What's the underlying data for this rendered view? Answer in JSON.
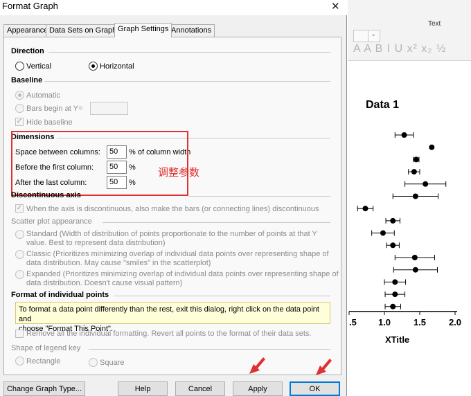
{
  "dialog": {
    "title": "Format Graph",
    "tabs": [
      "Appearance",
      "Data Sets on Graph",
      "Graph Settings",
      "Annotations"
    ],
    "active_tab": "Graph Settings"
  },
  "direction": {
    "title": "Direction",
    "vertical_label": "Vertical",
    "horizontal_label": "Horizontal",
    "selected": "Horizontal"
  },
  "baseline": {
    "title": "Baseline",
    "automatic_label": "Automatic",
    "bars_begin_label": "Bars begin at Y=",
    "bars_begin_value": "",
    "hide_baseline_label": "Hide baseline"
  },
  "dimensions": {
    "title": "Dimensions",
    "space_label": "Space between columns:",
    "space_value": "50",
    "space_unit": "% of column width",
    "before_label": "Before the first column:",
    "before_value": "50",
    "before_unit": "%",
    "after_label": "After the last column:",
    "after_value": "50",
    "after_unit": "%"
  },
  "annotation_text": "调整参数",
  "discontinuous": {
    "title": "Discontinuous axis",
    "option_label": "When the axis is discontinuous, also make the bars (or connecting lines) discontinuous"
  },
  "scatter": {
    "title": "Scatter plot appearance",
    "standard_line1": "Standard (Width of distribution of points proportionate to the number of points at that Y",
    "standard_line2": "value. Best to represent data distribution)",
    "classic_line1": "Classic (Prioritizes minimizing overlap of individual data points over representing shape of",
    "classic_line2": "data distribution. May cause \"smiles\" in the scatterplot)",
    "expanded_line1": "Expanded (Prioritizes minimizing overlap of individual data points over representing shape of",
    "expanded_line2": "data distribution. Doesn't cause visual pattern)"
  },
  "individual_points": {
    "title": "Format of individual points",
    "info_line1": "To format a data point differently than the rest, exit this dialog, right click on the data point and",
    "info_line2": "choose \"Format This Point\".",
    "remove_label": "Remove all the individual formatting. Revert all points to the format of their data sets."
  },
  "legend_key": {
    "title": "Shape of legend key",
    "rectangle_label": "Rectangle",
    "square_label": "Square"
  },
  "buttons": {
    "change_graph_type": "Change Graph Type...",
    "help": "Help",
    "cancel": "Cancel",
    "apply": "Apply",
    "ok": "OK"
  },
  "ribbon": {
    "section_label": "Text",
    "format_glyphs": "A A B I U x² x₂ ½"
  },
  "colors": {
    "highlight_red": "#e03030",
    "dialog_bg": "#f0f0f0",
    "default_button_border": "#0078d7",
    "info_box_bg": "#fefed9"
  },
  "chart_data": {
    "type": "scatter",
    "title": "Data 1",
    "xlabel": "XTitle",
    "x_tick_labels": [
      ".5",
      "1.0",
      "1.5",
      "2.0"
    ],
    "xlim": [
      0.5,
      2.0
    ],
    "points": [
      {
        "mean": 1.28,
        "err": 0.13
      },
      {
        "mean": 1.67,
        "err": 0
      },
      {
        "mean": 1.45,
        "err": 0.04
      },
      {
        "mean": 1.42,
        "err": 0.08
      },
      {
        "mean": 1.58,
        "err": 0.29
      },
      {
        "mean": 1.44,
        "err": 0.32
      },
      {
        "mean": 0.73,
        "err": 0.11
      },
      {
        "mean": 1.12,
        "err": 0.1
      },
      {
        "mean": 0.98,
        "err": 0.16
      },
      {
        "mean": 1.12,
        "err": 0.09
      },
      {
        "mean": 1.43,
        "err": 0.28
      },
      {
        "mean": 1.44,
        "err": 0.31
      },
      {
        "mean": 1.15,
        "err": 0.15
      },
      {
        "mean": 1.15,
        "err": 0.14
      },
      {
        "mean": 1.12,
        "err": 0.11
      }
    ]
  }
}
